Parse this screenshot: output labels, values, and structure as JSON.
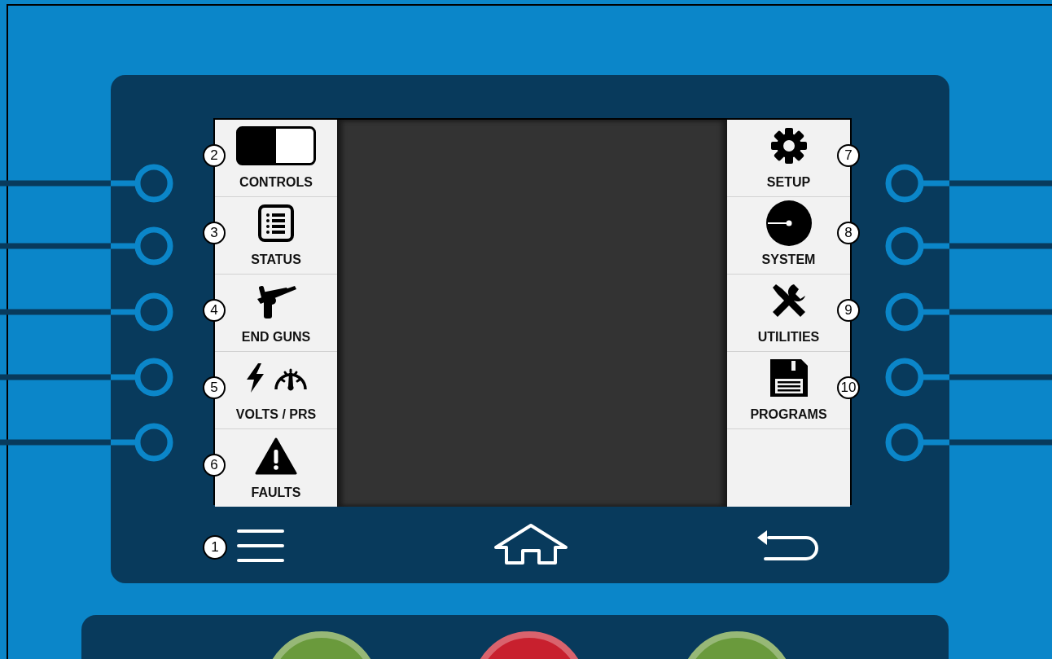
{
  "left_menu": [
    {
      "callout": "2",
      "label": "CONTROLS"
    },
    {
      "callout": "3",
      "label": "STATUS"
    },
    {
      "callout": "4",
      "label": "END GUNS"
    },
    {
      "callout": "5",
      "label": "VOLTS / PRS"
    },
    {
      "callout": "6",
      "label": "FAULTS"
    }
  ],
  "right_menu": [
    {
      "callout": "7",
      "label": "SETUP"
    },
    {
      "callout": "8",
      "label": "SYSTEM"
    },
    {
      "callout": "9",
      "label": "UTILITIES"
    },
    {
      "callout": "10",
      "label": "PROGRAMS"
    }
  ],
  "nav": {
    "menu_callout": "1"
  },
  "bottom_buttons": [
    {
      "color": "#6a9a3c"
    },
    {
      "color": "#c8202e"
    },
    {
      "color": "#6a9a3c"
    }
  ]
}
